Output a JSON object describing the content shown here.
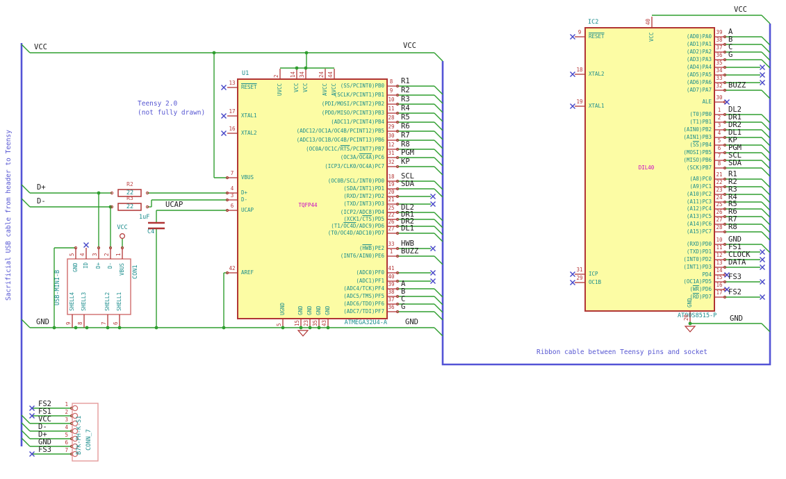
{
  "notes": {
    "usb_cable": "Sacrificial USB cable from header to Teensy",
    "teensy_1": "Teensy 2.0",
    "teensy_2": "(not fully drawn)",
    "ribbon": "Ribbon cable between Teensy pins and socket"
  },
  "power": {
    "vcc_left": "VCC",
    "vcc_mid": "VCC",
    "vcc_right": "VCC",
    "vcc_usb": "VCC",
    "gnd_left": "GND",
    "gnd_mid": "GND",
    "gnd_right": "GND",
    "dplus": "D+",
    "dminus": "D-",
    "ucap": "UCAP"
  },
  "colors": {
    "wire": "#2f9e2f",
    "bus": "#5353d6",
    "component": "#b03434",
    "body_fill": "#fcfca4",
    "pin_name": "#1a8c8c",
    "pin_number": "#b43434",
    "net_label": "#1c1c1c",
    "noconnect": "#4646c8",
    "note": "#5757d2",
    "footprint": "#c800c8"
  },
  "u1": {
    "ref": "U1",
    "footprint": "TQFP44",
    "part": "ATMEGA32U4-A",
    "top_pins": [
      {
        "num": "2",
        "name": "UVCC"
      },
      {
        "num": "14",
        "name": "VCC"
      },
      {
        "num": "34",
        "name": "VCC"
      },
      {
        "num": "24",
        "name": "AVCC"
      },
      {
        "num": "44",
        "name": "AVCC"
      }
    ],
    "bottom_pins": [
      {
        "num": "5",
        "name": "UGND"
      },
      {
        "num": "15",
        "name": "GND"
      },
      {
        "num": "23",
        "name": "GND"
      },
      {
        "num": "35",
        "name": "GND"
      },
      {
        "num": "43",
        "name": "GND"
      }
    ],
    "left_pins": [
      {
        "num": "13",
        "name": "~RESET~"
      },
      {
        "num": "17",
        "name": "XTAL1"
      },
      {
        "num": "16",
        "name": "XTAL2"
      },
      {
        "num": "7",
        "name": "VBUS"
      },
      {
        "num": "4",
        "name": "D+"
      },
      {
        "num": "3",
        "name": "D-"
      },
      {
        "num": "6",
        "name": "UCAP"
      },
      {
        "num": "42",
        "name": "AREF"
      }
    ],
    "right_pins": [
      {
        "num": "8",
        "name": "(SS/PCINT0)PB0",
        "label": "R1"
      },
      {
        "num": "9",
        "name": "(SCLK/PCINT1)PB1",
        "label": "R2"
      },
      {
        "num": "10",
        "name": "(PDI/MOSI/PCINT2)PB2",
        "label": "R3"
      },
      {
        "num": "11",
        "name": "(PDO/MISO/PCINT3)PB3",
        "label": "R4"
      },
      {
        "num": "28",
        "name": "(ADC11/PCINT4)PB4",
        "label": "R5"
      },
      {
        "num": "29",
        "name": "(ADC12/OC1A/OC4B/PCINT12)PB5",
        "label": "R6"
      },
      {
        "num": "30",
        "name": "(ADC13/OC1B/OC4B/PCINT13)PB6",
        "label": "R7"
      },
      {
        "num": "12",
        "name": "(OC0A/OC1C/~RTS~/PCINT7)PB7",
        "label": "R8"
      },
      {
        "num": "31",
        "name": "(OC3A/~OC4A~)PC6",
        "label": "PGM"
      },
      {
        "num": "32",
        "name": "(ICP3/CLK0/OC4A)PC7",
        "label": "KP"
      },
      {
        "num": "18",
        "name": "(OC0B/SCL/INT0)PD0",
        "label": "SCL"
      },
      {
        "num": "19",
        "name": "(SDA/INT1)PD1",
        "label": "SDA"
      },
      {
        "num": "20",
        "name": "(RXD/INT2)PD2",
        "label": ""
      },
      {
        "num": "21",
        "name": "(TXD/INT3)PD3",
        "label": ""
      },
      {
        "num": "25",
        "name": "(ICP2/ADC8)PD4",
        "label": "DL2"
      },
      {
        "num": "22",
        "name": "(XCK1/~CTS~)PD5",
        "label": "DR1"
      },
      {
        "num": "26",
        "name": "(T1/~OC4D~/ADC9)PD6",
        "label": "DR2"
      },
      {
        "num": "27",
        "name": "(T0/OC4D/ADC10)PD7",
        "label": "DL1"
      },
      {
        "num": "33",
        "name": "(~HWB~)PE2",
        "label": "HWB"
      },
      {
        "num": "1",
        "name": "(INT6/AIN0)PE6",
        "label": "BUZZ"
      },
      {
        "num": "41",
        "name": "(ADC0)PF0",
        "label": ""
      },
      {
        "num": "40",
        "name": "(ADC1)PF1",
        "label": ""
      },
      {
        "num": "39",
        "name": "(ADC4/TCK)PF4",
        "label": "A"
      },
      {
        "num": "38",
        "name": "(ADC5/TMS)PF5",
        "label": "B"
      },
      {
        "num": "37",
        "name": "(ADC6/TDO)PF6",
        "label": "C"
      },
      {
        "num": "36",
        "name": "(ADC7/TDI)PF7",
        "label": "G"
      }
    ]
  },
  "ic2": {
    "ref": "IC2",
    "footprint": "DIL40",
    "part": "AT90S8515-P",
    "top_pin": {
      "num": "40",
      "name": "VCC"
    },
    "bottom_pin": {
      "num": "20",
      "name": "GND"
    },
    "left_pins": [
      {
        "num": "9",
        "name": "~RESET~"
      },
      {
        "num": "18",
        "name": "XTAL2"
      },
      {
        "num": "19",
        "name": "XTAL1"
      },
      {
        "num": "31",
        "name": "ICP"
      },
      {
        "num": "29",
        "name": "OC1B"
      }
    ],
    "right_pins": [
      {
        "num": "39",
        "name": "(AD0)PA0",
        "label": "A"
      },
      {
        "num": "38",
        "name": "(AD1)PA1",
        "label": "B"
      },
      {
        "num": "37",
        "name": "(AD2)PA2",
        "label": "C"
      },
      {
        "num": "36",
        "name": "(AD3)PA3",
        "label": "G"
      },
      {
        "num": "35",
        "name": "(AD4)PA4",
        "label": ""
      },
      {
        "num": "34",
        "name": "(AD5)PA5",
        "label": ""
      },
      {
        "num": "33",
        "name": "(AD6)PA6",
        "label": ""
      },
      {
        "num": "32",
        "name": "(AD7)PA7",
        "label": "BUZZ"
      },
      {
        "num": "30",
        "name": "ALE",
        "label": ""
      },
      {
        "num": "1",
        "name": "(T0)PB0",
        "label": "DL2"
      },
      {
        "num": "2",
        "name": "(T1)PB1",
        "label": "DR1"
      },
      {
        "num": "3",
        "name": "(AIN0)PB2",
        "label": "DR2"
      },
      {
        "num": "4",
        "name": "(AIN1)PB3",
        "label": "DL1"
      },
      {
        "num": "5",
        "name": "(~SS~)PB4",
        "label": "KP"
      },
      {
        "num": "6",
        "name": "(MOSI)PB5",
        "label": "PGM"
      },
      {
        "num": "7",
        "name": "(MISO)PB6",
        "label": "SCL"
      },
      {
        "num": "8",
        "name": "(SCK)PB7",
        "label": "SDA"
      },
      {
        "num": "21",
        "name": "(A8)PC0",
        "label": "R1"
      },
      {
        "num": "22",
        "name": "(A9)PC1",
        "label": "R2"
      },
      {
        "num": "23",
        "name": "(A10)PC2",
        "label": "R3"
      },
      {
        "num": "24",
        "name": "(A11)PC3",
        "label": "R4"
      },
      {
        "num": "25",
        "name": "(A12)PC4",
        "label": "R5"
      },
      {
        "num": "26",
        "name": "(A13)PC5",
        "label": "R6"
      },
      {
        "num": "27",
        "name": "(A14)PC6",
        "label": "R7"
      },
      {
        "num": "28",
        "name": "(A15)PC7",
        "label": "R8"
      },
      {
        "num": "10",
        "name": "(RXD)PD0",
        "label": "GND"
      },
      {
        "num": "11",
        "name": "(TXD)PD1",
        "label": "FS1"
      },
      {
        "num": "12",
        "name": "(INT0)PD2",
        "label": "CLOCK"
      },
      {
        "num": "13",
        "name": "(INT1)PD3",
        "label": "DATA"
      },
      {
        "num": "14",
        "name": "PD4",
        "label": ""
      },
      {
        "num": "15",
        "name": "(OC1A)PD5",
        "label": "FS3"
      },
      {
        "num": "16",
        "name": "(~WR~)PD6",
        "label": ""
      },
      {
        "num": "17",
        "name": "(~RD~)PD7",
        "label": "FS2"
      }
    ]
  },
  "con1": {
    "ref": "CON1",
    "value": "USB-MINI-B",
    "top_pins": [
      {
        "num": "5",
        "name": "GND"
      },
      {
        "num": "4",
        "name": "ID"
      },
      {
        "num": "3",
        "name": "D+"
      },
      {
        "num": "2",
        "name": "D-"
      },
      {
        "num": "1",
        "name": "VBUS"
      }
    ],
    "bottom_pins": [
      {
        "num": "9",
        "name": "SHELL4"
      },
      {
        "num": "8",
        "name": "SHELL3"
      },
      {
        "num": "7",
        "name": "SHELL2"
      },
      {
        "num": "6",
        "name": "SHELL1"
      }
    ]
  },
  "conn7": {
    "ref": "CONN_7",
    "value": "B7K-PH-K-S1",
    "pins": [
      {
        "num": "1",
        "label": "FS2"
      },
      {
        "num": "2",
        "label": "FS1"
      },
      {
        "num": "3",
        "label": "VCC"
      },
      {
        "num": "4",
        "label": "D-"
      },
      {
        "num": "5",
        "label": "D+"
      },
      {
        "num": "6",
        "label": "GND"
      },
      {
        "num": "7",
        "label": "FS3"
      }
    ]
  },
  "r2": {
    "ref": "R2",
    "value": "22"
  },
  "r3": {
    "ref": "R3",
    "value": "22"
  },
  "c4": {
    "ref": "C4",
    "value": "1uF"
  }
}
